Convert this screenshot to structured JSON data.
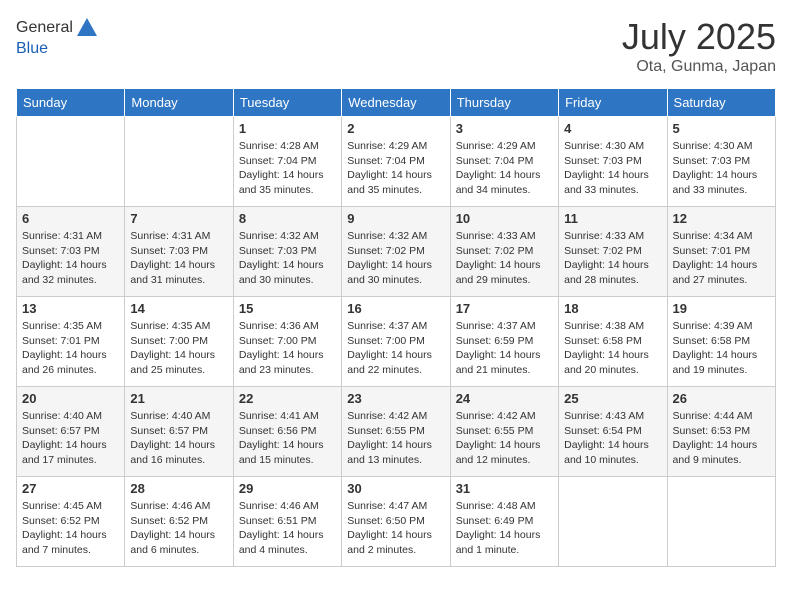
{
  "logo": {
    "general": "General",
    "blue": "Blue"
  },
  "title": "July 2025",
  "location": "Ota, Gunma, Japan",
  "days_of_week": [
    "Sunday",
    "Monday",
    "Tuesday",
    "Wednesday",
    "Thursday",
    "Friday",
    "Saturday"
  ],
  "weeks": [
    [
      {
        "day": "",
        "sunrise": "",
        "sunset": "",
        "daylight": ""
      },
      {
        "day": "",
        "sunrise": "",
        "sunset": "",
        "daylight": ""
      },
      {
        "day": "1",
        "sunrise": "Sunrise: 4:28 AM",
        "sunset": "Sunset: 7:04 PM",
        "daylight": "Daylight: 14 hours and 35 minutes."
      },
      {
        "day": "2",
        "sunrise": "Sunrise: 4:29 AM",
        "sunset": "Sunset: 7:04 PM",
        "daylight": "Daylight: 14 hours and 35 minutes."
      },
      {
        "day": "3",
        "sunrise": "Sunrise: 4:29 AM",
        "sunset": "Sunset: 7:04 PM",
        "daylight": "Daylight: 14 hours and 34 minutes."
      },
      {
        "day": "4",
        "sunrise": "Sunrise: 4:30 AM",
        "sunset": "Sunset: 7:03 PM",
        "daylight": "Daylight: 14 hours and 33 minutes."
      },
      {
        "day": "5",
        "sunrise": "Sunrise: 4:30 AM",
        "sunset": "Sunset: 7:03 PM",
        "daylight": "Daylight: 14 hours and 33 minutes."
      }
    ],
    [
      {
        "day": "6",
        "sunrise": "Sunrise: 4:31 AM",
        "sunset": "Sunset: 7:03 PM",
        "daylight": "Daylight: 14 hours and 32 minutes."
      },
      {
        "day": "7",
        "sunrise": "Sunrise: 4:31 AM",
        "sunset": "Sunset: 7:03 PM",
        "daylight": "Daylight: 14 hours and 31 minutes."
      },
      {
        "day": "8",
        "sunrise": "Sunrise: 4:32 AM",
        "sunset": "Sunset: 7:03 PM",
        "daylight": "Daylight: 14 hours and 30 minutes."
      },
      {
        "day": "9",
        "sunrise": "Sunrise: 4:32 AM",
        "sunset": "Sunset: 7:02 PM",
        "daylight": "Daylight: 14 hours and 30 minutes."
      },
      {
        "day": "10",
        "sunrise": "Sunrise: 4:33 AM",
        "sunset": "Sunset: 7:02 PM",
        "daylight": "Daylight: 14 hours and 29 minutes."
      },
      {
        "day": "11",
        "sunrise": "Sunrise: 4:33 AM",
        "sunset": "Sunset: 7:02 PM",
        "daylight": "Daylight: 14 hours and 28 minutes."
      },
      {
        "day": "12",
        "sunrise": "Sunrise: 4:34 AM",
        "sunset": "Sunset: 7:01 PM",
        "daylight": "Daylight: 14 hours and 27 minutes."
      }
    ],
    [
      {
        "day": "13",
        "sunrise": "Sunrise: 4:35 AM",
        "sunset": "Sunset: 7:01 PM",
        "daylight": "Daylight: 14 hours and 26 minutes."
      },
      {
        "day": "14",
        "sunrise": "Sunrise: 4:35 AM",
        "sunset": "Sunset: 7:00 PM",
        "daylight": "Daylight: 14 hours and 25 minutes."
      },
      {
        "day": "15",
        "sunrise": "Sunrise: 4:36 AM",
        "sunset": "Sunset: 7:00 PM",
        "daylight": "Daylight: 14 hours and 23 minutes."
      },
      {
        "day": "16",
        "sunrise": "Sunrise: 4:37 AM",
        "sunset": "Sunset: 7:00 PM",
        "daylight": "Daylight: 14 hours and 22 minutes."
      },
      {
        "day": "17",
        "sunrise": "Sunrise: 4:37 AM",
        "sunset": "Sunset: 6:59 PM",
        "daylight": "Daylight: 14 hours and 21 minutes."
      },
      {
        "day": "18",
        "sunrise": "Sunrise: 4:38 AM",
        "sunset": "Sunset: 6:58 PM",
        "daylight": "Daylight: 14 hours and 20 minutes."
      },
      {
        "day": "19",
        "sunrise": "Sunrise: 4:39 AM",
        "sunset": "Sunset: 6:58 PM",
        "daylight": "Daylight: 14 hours and 19 minutes."
      }
    ],
    [
      {
        "day": "20",
        "sunrise": "Sunrise: 4:40 AM",
        "sunset": "Sunset: 6:57 PM",
        "daylight": "Daylight: 14 hours and 17 minutes."
      },
      {
        "day": "21",
        "sunrise": "Sunrise: 4:40 AM",
        "sunset": "Sunset: 6:57 PM",
        "daylight": "Daylight: 14 hours and 16 minutes."
      },
      {
        "day": "22",
        "sunrise": "Sunrise: 4:41 AM",
        "sunset": "Sunset: 6:56 PM",
        "daylight": "Daylight: 14 hours and 15 minutes."
      },
      {
        "day": "23",
        "sunrise": "Sunrise: 4:42 AM",
        "sunset": "Sunset: 6:55 PM",
        "daylight": "Daylight: 14 hours and 13 minutes."
      },
      {
        "day": "24",
        "sunrise": "Sunrise: 4:42 AM",
        "sunset": "Sunset: 6:55 PM",
        "daylight": "Daylight: 14 hours and 12 minutes."
      },
      {
        "day": "25",
        "sunrise": "Sunrise: 4:43 AM",
        "sunset": "Sunset: 6:54 PM",
        "daylight": "Daylight: 14 hours and 10 minutes."
      },
      {
        "day": "26",
        "sunrise": "Sunrise: 4:44 AM",
        "sunset": "Sunset: 6:53 PM",
        "daylight": "Daylight: 14 hours and 9 minutes."
      }
    ],
    [
      {
        "day": "27",
        "sunrise": "Sunrise: 4:45 AM",
        "sunset": "Sunset: 6:52 PM",
        "daylight": "Daylight: 14 hours and 7 minutes."
      },
      {
        "day": "28",
        "sunrise": "Sunrise: 4:46 AM",
        "sunset": "Sunset: 6:52 PM",
        "daylight": "Daylight: 14 hours and 6 minutes."
      },
      {
        "day": "29",
        "sunrise": "Sunrise: 4:46 AM",
        "sunset": "Sunset: 6:51 PM",
        "daylight": "Daylight: 14 hours and 4 minutes."
      },
      {
        "day": "30",
        "sunrise": "Sunrise: 4:47 AM",
        "sunset": "Sunset: 6:50 PM",
        "daylight": "Daylight: 14 hours and 2 minutes."
      },
      {
        "day": "31",
        "sunrise": "Sunrise: 4:48 AM",
        "sunset": "Sunset: 6:49 PM",
        "daylight": "Daylight: 14 hours and 1 minute."
      },
      {
        "day": "",
        "sunrise": "",
        "sunset": "",
        "daylight": ""
      },
      {
        "day": "",
        "sunrise": "",
        "sunset": "",
        "daylight": ""
      }
    ]
  ]
}
